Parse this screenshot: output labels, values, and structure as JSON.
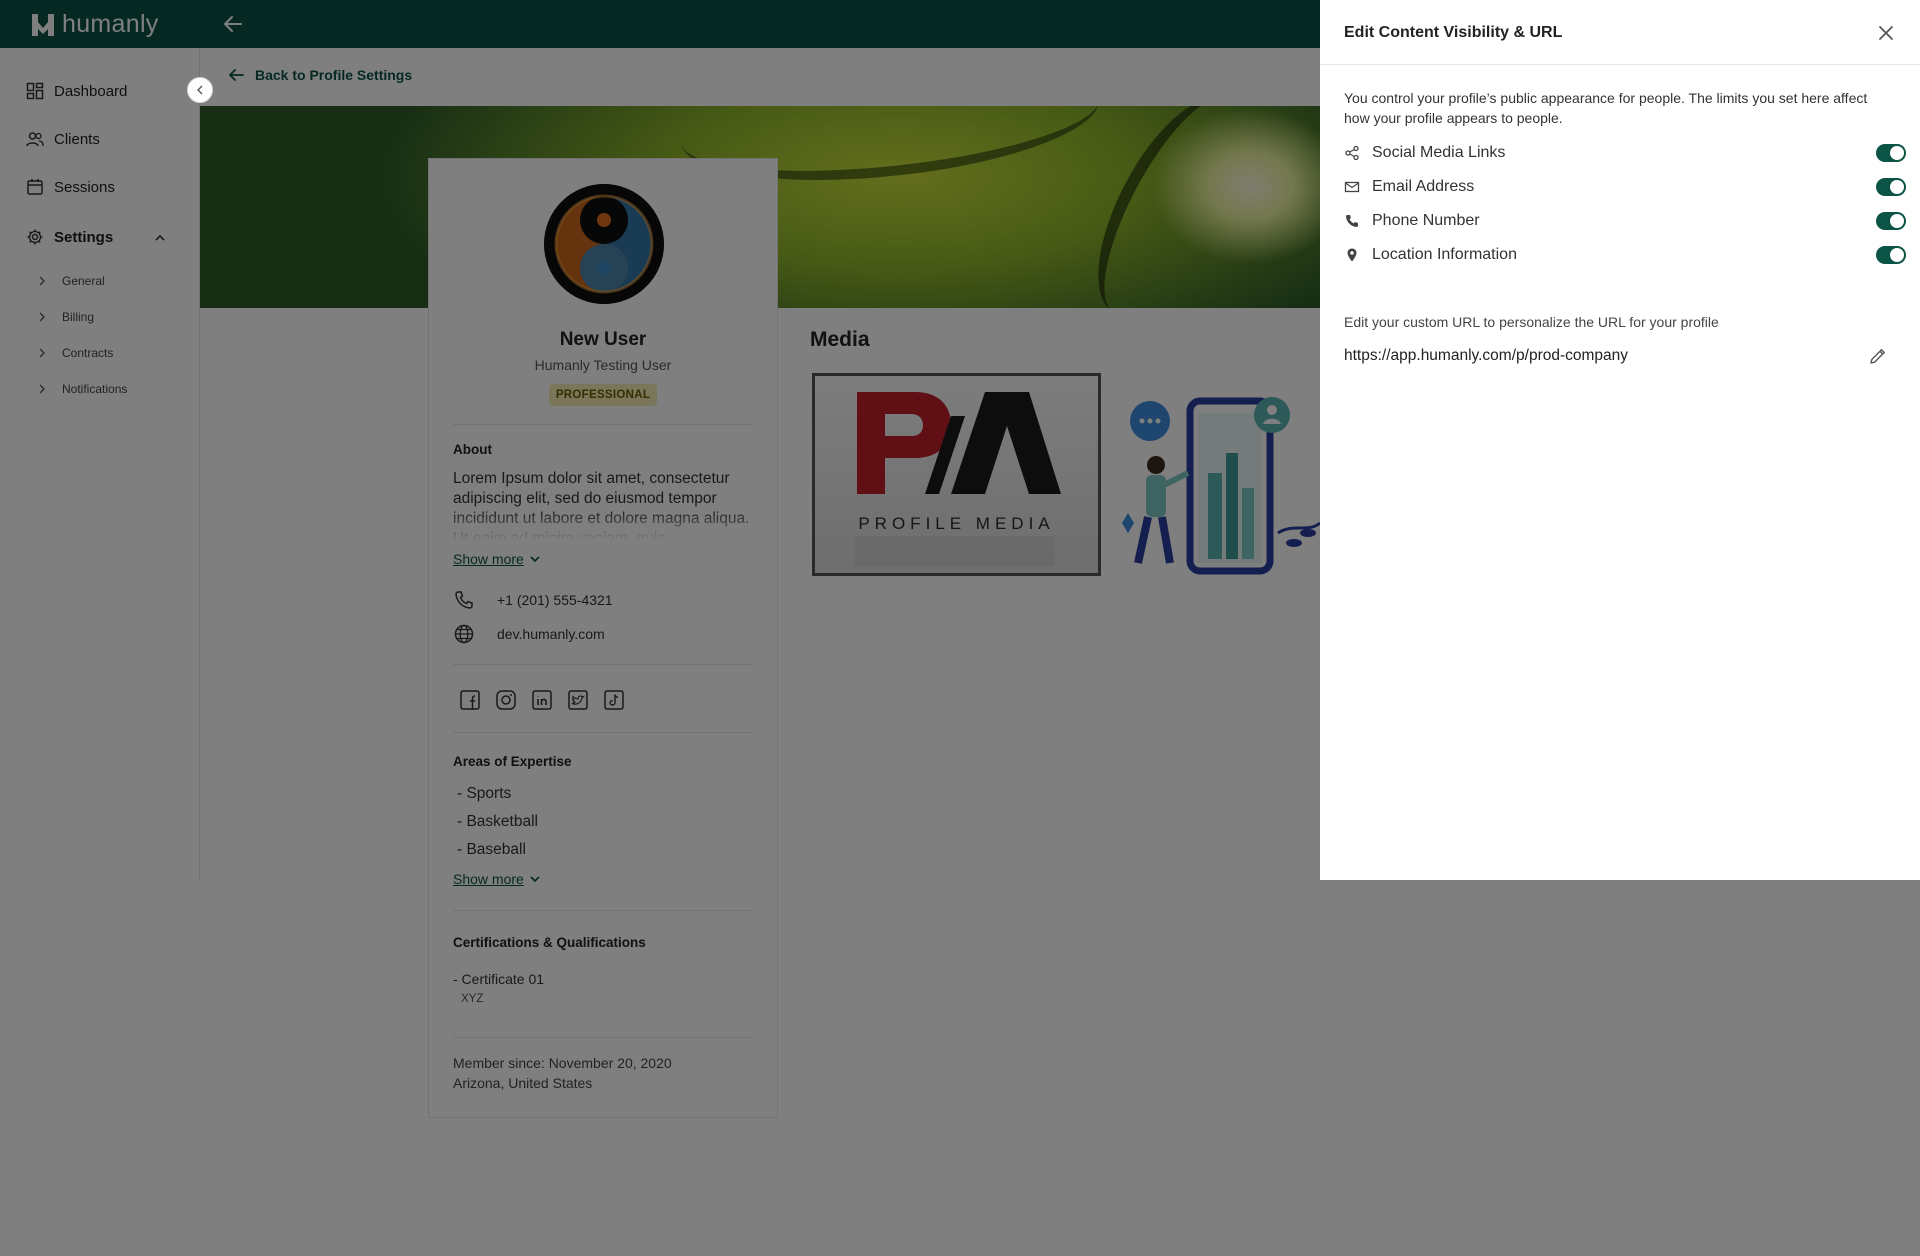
{
  "app": {
    "logo_text": "humanly"
  },
  "sidebar": {
    "items": [
      {
        "label": "Dashboard",
        "icon": "dashboard-icon"
      },
      {
        "label": "Clients",
        "icon": "users-icon"
      },
      {
        "label": "Sessions",
        "icon": "calendar-icon"
      },
      {
        "label": "Settings",
        "icon": "gear-icon"
      }
    ],
    "sub_items": [
      {
        "label": "General"
      },
      {
        "label": "Billing"
      },
      {
        "label": "Contracts"
      },
      {
        "label": "Notifications"
      }
    ]
  },
  "main": {
    "back_label": "Back to Profile Settings",
    "profile": {
      "name": "New User",
      "subtitle": "Humanly Testing User",
      "badge": "PROFESSIONAL",
      "about_title": "About",
      "about_text": "Lorem Ipsum dolor sit amet, consectetur adipiscing elit, sed do eiusmod tempor incididunt ut labore et dolore magna aliqua. Ut enim ad minim veniam, quis",
      "show_more": "Show more",
      "phone": "+1 (201) 555-4321",
      "website": "dev.humanly.com",
      "social_icons": [
        "facebook-icon",
        "instagram-icon",
        "linkedin-icon",
        "twitter-icon",
        "tiktok-icon"
      ],
      "expertise_title": "Areas of Expertise",
      "expertise": [
        "- Sports",
        "- Basketball",
        "- Baseball"
      ],
      "certs_title": "Certifications & Qualifications",
      "cert_name": "- Certificate 01",
      "cert_issuer": "XYZ",
      "member_since": "Member since: November 20, 2020",
      "location": "Arizona, United States"
    },
    "media_title": "Media",
    "media1_text": "PROFILE MEDIA"
  },
  "drawer": {
    "title": "Edit Content Visibility & URL",
    "description": "You control your profile’s public appearance for people. The limits you set here affect how your profile appears to people.",
    "options": [
      {
        "label": "Social Media Links",
        "icon": "share-icon",
        "enabled": true
      },
      {
        "label": "Email Address",
        "icon": "mail-icon",
        "enabled": true
      },
      {
        "label": "Phone Number",
        "icon": "phone-icon",
        "enabled": true
      },
      {
        "label": "Location Information",
        "icon": "location-pin-icon",
        "enabled": true
      }
    ],
    "url_description": "Edit your custom URL to personalize the URL for your profile",
    "url_value": "https://app.humanly.com/p/prod-company"
  },
  "colors": {
    "brand": "#0b5345",
    "badge_bg": "#f5edb5",
    "badge_text": "#6d5a00",
    "overlay": "rgba(0,0,0,0.5)"
  }
}
